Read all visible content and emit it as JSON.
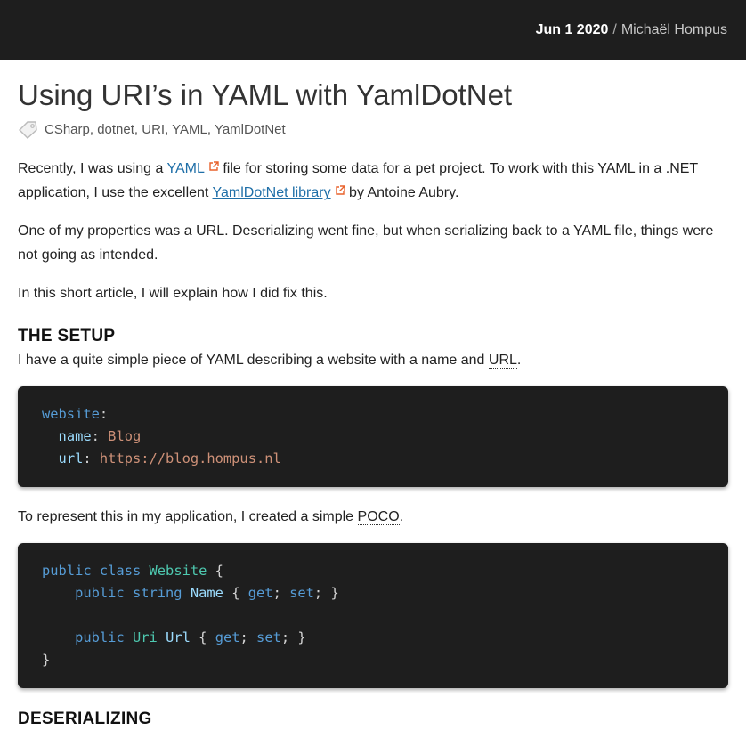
{
  "header": {
    "date": "Jun 1 2020",
    "separator": "/",
    "author": "Michaël Hompus"
  },
  "article": {
    "title": "Using URI’s in YAML with YamlDotNet",
    "tags": "CSharp, dotnet, URI, YAML, YamlDotNet",
    "p1": {
      "t1": "Recently, I was using a ",
      "link1": "YAML",
      "t2": " file for storing some data for a pet project. To work with this YAML in a .NET application, I use the excellent ",
      "link2": "YamlDotNet library",
      "t3": " by Antoine Aubry."
    },
    "p2": {
      "t1": "One of my properties was a ",
      "abbr": "URL",
      "t2": ". Deserializing went fine, but when serializing back to a YAML file, things were not going as intended."
    },
    "p3": "In this short article, I will explain how I did fix this.",
    "section1": {
      "heading": "THE SETUP",
      "p1": "I have a quite simple piece of YAML describing a website with a name and ",
      "abbr": "URL",
      "p1_end": "."
    },
    "yaml": {
      "k1": "website",
      "k2": "name",
      "v2": "Blog",
      "k3": "url",
      "v3": "https://blog.hompus.nl"
    },
    "p4": {
      "t1": "To represent this in my application, I created a simple ",
      "abbr": "POCO",
      "t2": "."
    },
    "csharp": {
      "public": "public",
      "class": "class",
      "classname": "Website",
      "string": "string",
      "prop1": "Name",
      "get": "get",
      "set": "set",
      "uri": "Uri",
      "prop2": "Url"
    },
    "section2": {
      "heading": "DESERIALIZING"
    }
  },
  "colors": {
    "header_bg": "#1e1e1e",
    "link": "#1f6fa8",
    "external_icon": "#e8622c",
    "code_bg": "#1e1e1e"
  }
}
